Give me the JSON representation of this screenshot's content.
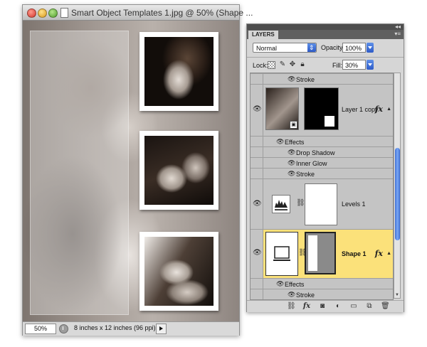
{
  "document_window": {
    "title": "Smart Object Templates 1.jpg @ 50% (Shape ...",
    "status": {
      "zoom": "50%",
      "doc_size": "8 inches x 12 inches (96 ppi)"
    },
    "icons": [
      "close-light",
      "minimize-light",
      "zoom-light",
      "file-icon",
      "info-icon",
      "status-menu-arrow-icon"
    ]
  },
  "layers_panel": {
    "tab_label": "LAYERS",
    "blend_mode": "Normal",
    "opacity_label": "Opacity:",
    "opacity_value": "100%",
    "lock_label": "Lock:",
    "fill_label": "Fill:",
    "fill_value": "30%",
    "rows": [
      {
        "type": "effect",
        "label": "Stroke"
      },
      {
        "type": "layer",
        "label": "Layer 1 copy",
        "fx": "fx",
        "selected": false
      },
      {
        "type": "effects-header",
        "label": "Effects"
      },
      {
        "type": "effect",
        "label": "Drop Shadow"
      },
      {
        "type": "effect",
        "label": "Inner Glow"
      },
      {
        "type": "effect",
        "label": "Stroke"
      },
      {
        "type": "adjustment-layer",
        "label": "Levels 1"
      },
      {
        "type": "layer",
        "label": "Shape 1",
        "fx": "fx",
        "selected": true
      },
      {
        "type": "effects-header",
        "label": "Effects"
      },
      {
        "type": "effect",
        "label": "Stroke"
      }
    ],
    "bottom_icons": [
      "link-layers-icon",
      "fx-icon",
      "add-mask-icon",
      "adjustment-layer-icon",
      "new-group-icon",
      "new-layer-icon",
      "trash-icon"
    ],
    "colors": {
      "selected_row": "#fbe17a",
      "scroll_thumb": "#4a7be0"
    }
  }
}
